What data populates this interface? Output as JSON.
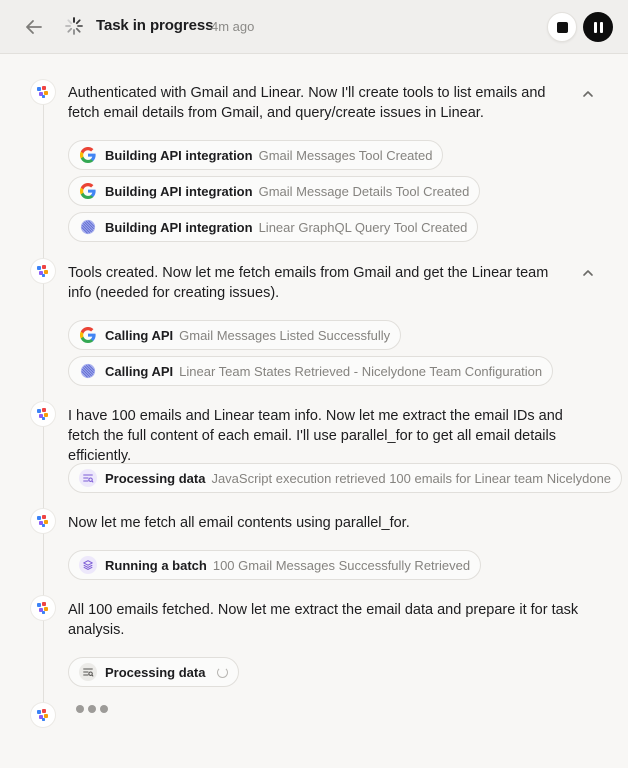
{
  "header": {
    "title": "Task in progress",
    "time": "4m ago"
  },
  "steps": [
    {
      "text": "Authenticated with Gmail and Linear. Now I'll create tools to list emails and fetch email details from Gmail, and query/create issues in Linear.",
      "chips": [
        {
          "icon": "google-icon",
          "label": "Building API integration",
          "desc": "Gmail Messages Tool Created"
        },
        {
          "icon": "google-icon",
          "label": "Building API integration",
          "desc": "Gmail Message Details Tool Created"
        },
        {
          "icon": "linear-icon",
          "label": "Building API integration",
          "desc": "Linear GraphQL Query Tool Created"
        }
      ]
    },
    {
      "text": "Tools created. Now let me fetch emails from Gmail and get the Linear team info (needed for creating issues).",
      "chips": [
        {
          "icon": "google-icon",
          "label": "Calling API",
          "desc": "Gmail Messages Listed Successfully"
        },
        {
          "icon": "linear-icon",
          "label": "Calling API",
          "desc": "Linear Team States Retrieved - Nicelydone Team Configuration"
        }
      ]
    },
    {
      "text": "I have 100 emails and Linear team info. Now let me extract the email IDs and fetch the full content of each email. I'll use parallel_for to get all email details efficiently.",
      "chips": [
        {
          "icon": "processing-icon",
          "label": "Processing data",
          "desc": "JavaScript execution retrieved 100 emails for Linear team Nicelydone"
        }
      ]
    },
    {
      "text": "Now let me fetch all email contents using parallel_for.",
      "chips": [
        {
          "icon": "batch-icon",
          "label": "Running a batch",
          "desc": "100 Gmail Messages Successfully Retrieved"
        }
      ]
    },
    {
      "text": "All 100 emails fetched. Now let me extract the email data and prepare it for task analysis.",
      "chips": [
        {
          "icon": "processing-icon",
          "label": "Processing data",
          "desc": ""
        }
      ]
    }
  ],
  "colors": {
    "background": "#f8f7f5",
    "header": "#f0efed",
    "processing_badge": "#ede8fb",
    "batch_badge": "#ede8fb",
    "linear_blue": "#5e6ad2"
  }
}
